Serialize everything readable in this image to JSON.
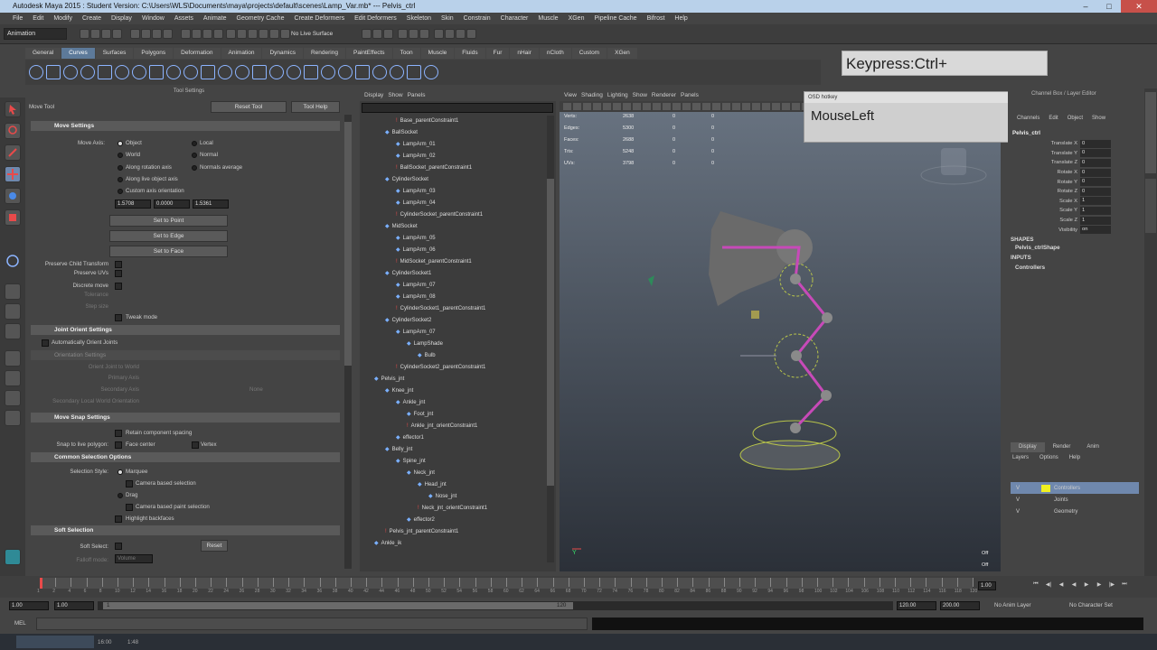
{
  "title": "Autodesk Maya 2015 : Student Version: C:\\Users\\WLS\\Documents\\maya\\projects\\default\\scenes\\Lamp_Var.mb* --- Pelvis_ctrl",
  "menu": [
    "File",
    "Edit",
    "Modify",
    "Create",
    "Display",
    "Window",
    "Assets",
    "Animate",
    "Geometry Cache",
    "Create Deformers",
    "Edit Deformers",
    "Skeleton",
    "Skin",
    "Constrain",
    "Character",
    "Muscle",
    "XGen",
    "Pipeline Cache",
    "Bifrost",
    "Help"
  ],
  "status": {
    "mode": "Animation",
    "live_surface": "No Live Surface"
  },
  "shelf_tabs": [
    "General",
    "Curves",
    "Surfaces",
    "Polygons",
    "Deformation",
    "Animation",
    "Dynamics",
    "Rendering",
    "PaintEffects",
    "Toon",
    "Muscle",
    "Fluids",
    "Fur",
    "nHair",
    "nCloth",
    "Custom",
    "XGen"
  ],
  "keypress": "Keypress:Ctrl+",
  "hotkey": {
    "title": "OSD hotkey",
    "text": "MouseLeft"
  },
  "tool_settings": {
    "header": "Tool Settings",
    "tool": "Move Tool",
    "reset": "Reset Tool",
    "help": "Tool Help",
    "move_settings": "Move Settings",
    "move_axis": "Move Axis:",
    "object": "Object",
    "local": "Local",
    "world": "World",
    "normal": "Normal",
    "along_rotation": "Along rotation axis",
    "normal_average": "Normals average",
    "along_live": "Along live object axis",
    "custom": "Custom axis orientation",
    "fields": [
      "1.5708",
      "0.0000",
      "1.5361"
    ],
    "set_point": "Set to Point",
    "set_edge": "Set to Edge",
    "set_face": "Set to Face",
    "preserve_child": "Preserve Child Transform",
    "preserve_uvs": "Preserve UVs",
    "discrete": "Discrete move",
    "tolerance": "Tolerance",
    "step_size": "Step size",
    "tweak": "Tweak mode",
    "joint_orient": "Joint Orient Settings",
    "auto_orient": "Automatically Orient Joints",
    "orient_settings": "Orientation Settings",
    "orient_joint": "Orient Joint to World",
    "primary": "Primary Axis",
    "secondary": "Secondary Axis",
    "secondary_world": "Secondary Local World Orientation",
    "none": "None",
    "move_snap": "Move Snap Settings",
    "retain": "Retain component spacing",
    "snap_live": "Snap to live polygon:",
    "face_center": "Face center",
    "vertex": "Vertex",
    "common": "Common Selection Options",
    "sel_style": "Selection Style:",
    "marquee": "Marquee",
    "camera_sel": "Camera based selection",
    "drag": "Drag",
    "camera_paint": "Camera based paint selection",
    "highlight": "Highlight backfaces",
    "soft": "Soft Selection",
    "soft_select": "Soft Select:",
    "reset2": "Reset",
    "falloff": "Falloff mode:",
    "falloff_val": "Volume"
  },
  "outliner": {
    "menu": [
      "Display",
      "Show",
      "Panels"
    ],
    "rows": [
      {
        "i": 2,
        "t": "Base_parentConstraint1",
        "c": true
      },
      {
        "i": 1,
        "t": "BallSocket"
      },
      {
        "i": 2,
        "t": "LampArm_01"
      },
      {
        "i": 2,
        "t": "LampArm_02"
      },
      {
        "i": 2,
        "t": "BallSocket_parentConstraint1",
        "c": true
      },
      {
        "i": 1,
        "t": "CylinderSocket"
      },
      {
        "i": 2,
        "t": "LampArm_03"
      },
      {
        "i": 2,
        "t": "LampArm_04"
      },
      {
        "i": 2,
        "t": "CylinderSocket_parentConstraint1",
        "c": true
      },
      {
        "i": 1,
        "t": "MidSocket"
      },
      {
        "i": 2,
        "t": "LampArm_05"
      },
      {
        "i": 2,
        "t": "LampArm_06"
      },
      {
        "i": 2,
        "t": "MidSocket_parentConstraint1",
        "c": true
      },
      {
        "i": 1,
        "t": "CylinderSocket1"
      },
      {
        "i": 2,
        "t": "LampArm_07"
      },
      {
        "i": 2,
        "t": "LampArm_08"
      },
      {
        "i": 2,
        "t": "CylinderSocket1_parentConstraint1",
        "c": true
      },
      {
        "i": 1,
        "t": "CylinderSocket2"
      },
      {
        "i": 2,
        "t": "LampArm_07"
      },
      {
        "i": 3,
        "t": "LampShade"
      },
      {
        "i": 4,
        "t": "Bulb"
      },
      {
        "i": 2,
        "t": "CylinderSocket2_parentConstraint1",
        "c": true
      },
      {
        "i": 0,
        "t": "Pelvis_jnt"
      },
      {
        "i": 1,
        "t": "Knee_jnt"
      },
      {
        "i": 2,
        "t": "Ankle_jnt"
      },
      {
        "i": 3,
        "t": "Foot_jnt"
      },
      {
        "i": 3,
        "t": "Ankle_jnt_orientConstraint1",
        "c": true
      },
      {
        "i": 2,
        "t": "effector1"
      },
      {
        "i": 1,
        "t": "Belly_jnt"
      },
      {
        "i": 2,
        "t": "Spine_jnt"
      },
      {
        "i": 3,
        "t": "Neck_jnt"
      },
      {
        "i": 4,
        "t": "Head_jnt"
      },
      {
        "i": 5,
        "t": "Nose_jnt"
      },
      {
        "i": 4,
        "t": "Neck_jnt_orientConstraint1",
        "c": true
      },
      {
        "i": 3,
        "t": "effector2"
      },
      {
        "i": 1,
        "t": "Pelvis_jnt_parentConstraint1",
        "c": true
      },
      {
        "i": 0,
        "t": "Ankle_ik"
      }
    ]
  },
  "viewport": {
    "menu": [
      "View",
      "Shading",
      "Lighting",
      "Show",
      "Renderer",
      "Panels"
    ],
    "hud": [
      [
        "Verts:",
        "2638",
        "0",
        "0"
      ],
      [
        "Edges:",
        "5300",
        "0",
        "0"
      ],
      [
        "Faces:",
        "2688",
        "0",
        "0"
      ],
      [
        "Tris:",
        "5248",
        "0",
        "0"
      ],
      [
        "UVs:",
        "3798",
        "0",
        "0"
      ]
    ],
    "off1": "Off",
    "off2": "Off"
  },
  "channel_box": {
    "menu": [
      "Channels",
      "Edit",
      "Object",
      "Show"
    ],
    "header": "Channel Box / Layer Editor",
    "node": "Pelvis_ctrl",
    "channels": [
      [
        "Translate X",
        "0"
      ],
      [
        "Translate Y",
        "0"
      ],
      [
        "Translate Z",
        "0"
      ],
      [
        "Rotate X",
        "0"
      ],
      [
        "Rotate Y",
        "0"
      ],
      [
        "Rotate Z",
        "0"
      ],
      [
        "Scale X",
        "1"
      ],
      [
        "Scale Y",
        "1"
      ],
      [
        "Scale Z",
        "1"
      ],
      [
        "Visibility",
        "on"
      ]
    ],
    "shapes": "SHAPES",
    "shape": "Pelvis_ctrlShape",
    "inputs": "INPUTS",
    "input": "Controllers"
  },
  "layers": {
    "tabs": [
      "Display",
      "Render",
      "Anim"
    ],
    "menu": [
      "Layers",
      "Options",
      "Help"
    ],
    "items": [
      "Controllers",
      "Joints",
      "Geometry"
    ]
  },
  "time": {
    "ticks": [
      "1",
      "2",
      "4",
      "6",
      "8",
      "10",
      "12",
      "14",
      "16",
      "18",
      "20",
      "22",
      "24",
      "26",
      "28",
      "30",
      "32",
      "34",
      "36",
      "38",
      "40",
      "42",
      "44",
      "46",
      "48",
      "50",
      "52",
      "54",
      "56",
      "58",
      "60",
      "62",
      "64",
      "66",
      "68",
      "70",
      "72",
      "74",
      "76",
      "78",
      "80",
      "82",
      "84",
      "86",
      "88",
      "90",
      "92",
      "94",
      "96",
      "98",
      "100",
      "102",
      "104",
      "106",
      "108",
      "110",
      "112",
      "114",
      "116",
      "118",
      "120"
    ],
    "current": "1.00"
  },
  "range": {
    "start": "1.00",
    "start2": "1.00",
    "cur": "1",
    "end_mark": "120",
    "end": "120.00",
    "end2": "200.00",
    "anim_layer": "No Anim Layer",
    "char_set": "No Character Set"
  },
  "cmd": {
    "label": "MEL"
  },
  "taskbar": {
    "clock1": "16:00",
    "clock2": "1:48"
  }
}
